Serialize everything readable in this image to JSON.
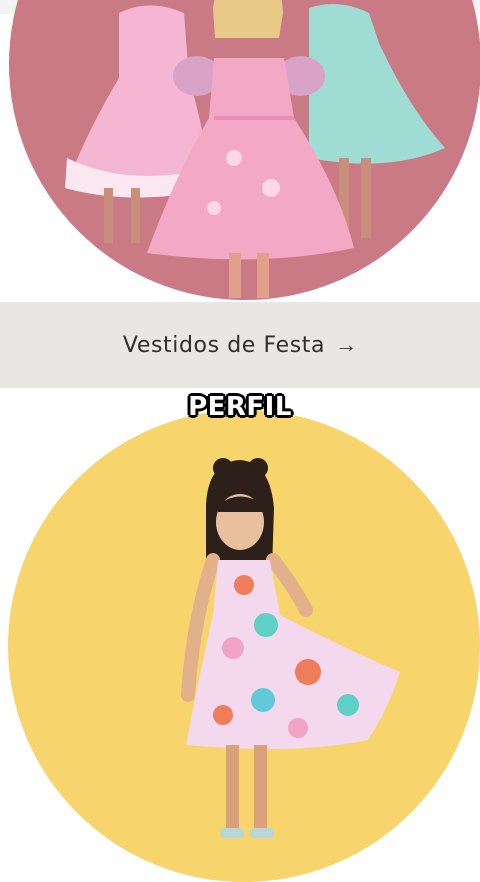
{
  "category": {
    "label": "Vestidos de Festa",
    "arrow_icon": "arrow-right-icon"
  },
  "caption": "PERFIL",
  "colors": {
    "top_circle_bg": "#c97a84",
    "bottom_circle_bg": "#f7d56c",
    "category_bar_bg": "#e9e7e3",
    "category_text": "#2f2f2f"
  },
  "images": [
    {
      "role": "party-dresses-photo"
    },
    {
      "role": "floral-dress-photo"
    }
  ]
}
